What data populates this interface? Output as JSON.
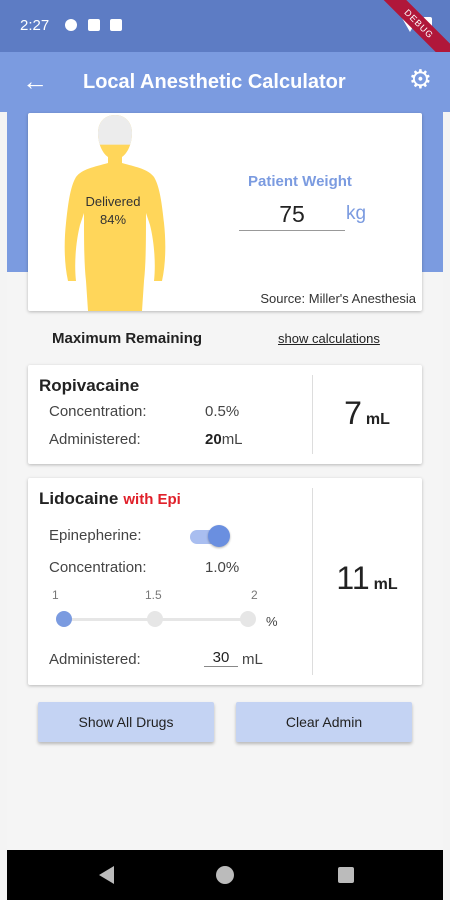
{
  "status": {
    "time": "2:27",
    "debug_label": "DEBUG"
  },
  "appbar": {
    "title": "Local Anesthetic Calculator"
  },
  "colors": {
    "primary": "#7b9be0",
    "statusbar": "#5d7cc4",
    "figure": "#ffd65a",
    "epi_red": "#e0202a"
  },
  "patient": {
    "delivered_label": "Delivered",
    "delivered_pct_text": "84%",
    "delivered_fraction": 0.84,
    "weight_label": "Patient Weight",
    "weight_value": "75",
    "weight_unit": "kg",
    "source": "Source: Miller's Anesthesia"
  },
  "section": {
    "title": "Maximum Remaining",
    "calc_link": "show calculations"
  },
  "drugs": [
    {
      "name": "Ropivacaine",
      "concentration_label": "Concentration:",
      "concentration_value": "0.5%",
      "administered_label": "Administered:",
      "administered_value": "20",
      "administered_unit": "mL",
      "max_remaining": "7",
      "max_unit": "mL"
    },
    {
      "name": "Lidocaine",
      "epi_tag": "with Epi",
      "epi_label": "Epinepherine:",
      "epi_on": true,
      "concentration_label": "Concentration:",
      "concentration_value": "1.0%",
      "slider_ticks": [
        "1",
        "1.5",
        "2"
      ],
      "slider_value": 1.0,
      "slider_unit": "%",
      "administered_label": "Administered:",
      "administered_value": "30",
      "administered_unit": "mL",
      "max_remaining": "11",
      "max_unit": "mL"
    }
  ],
  "buttons": {
    "show_all": "Show All Drugs",
    "clear": "Clear Admin"
  }
}
